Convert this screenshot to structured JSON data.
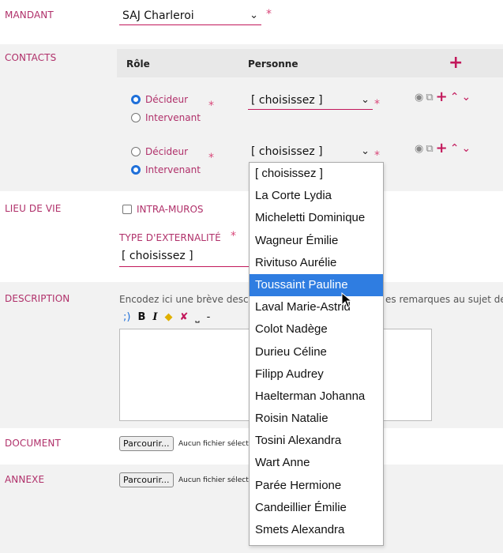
{
  "mandant": {
    "label": "MANDANT",
    "value": "SAJ Charleroi"
  },
  "contacts": {
    "label": "CONTACTS",
    "header_role": "Rôle",
    "header_person": "Personne",
    "entries": [
      {
        "role_decideur": "Décideur",
        "role_intervenant": "Intervenant",
        "person": "[ choisissez ]"
      },
      {
        "role_decideur": "Décideur",
        "role_intervenant": "Intervenant",
        "person": "[ choisissez ]"
      }
    ]
  },
  "lieu": {
    "label": "LIEU DE VIE",
    "intra_muros": "INTRA-MUROS",
    "type_label": "TYPE D'EXTERNALITÉ",
    "type_value": "[ choisissez ]"
  },
  "description": {
    "label": "DESCRIPTION",
    "hint_start": "Encodez ici une brève desc",
    "hint_end": "es remarques au sujet de",
    "toolbar": [
      ";)",
      "B",
      "I",
      "-"
    ]
  },
  "document": {
    "label": "DOCUMENT",
    "button": "Parcourir...",
    "status": "Aucun fichier sélect"
  },
  "annexe": {
    "label": "ANNEXE",
    "button": "Parcourir...",
    "status": "Aucun fichier sélect"
  },
  "dropdown": {
    "options": [
      "[ choisissez ]",
      "La Corte Lydia",
      "Micheletti Dominique",
      "Wagneur Émilie",
      "Rivituso Aurélie",
      "Toussaint Pauline",
      "Laval Marie-Astrid",
      "Colot Nadège",
      "Durieu Céline",
      "Filipp Audrey",
      "Haelterman Johanna",
      "Roisin Natalie",
      "Tosini Alexandra",
      "Wart Anne",
      "Parée Hermione",
      "Candeillier Émilie",
      "Smets Alexandra"
    ],
    "highlighted": "Toussaint Pauline"
  },
  "colors": {
    "accent": "#c2185b",
    "label": "#b0306a",
    "highlight": "#2f7de1"
  }
}
